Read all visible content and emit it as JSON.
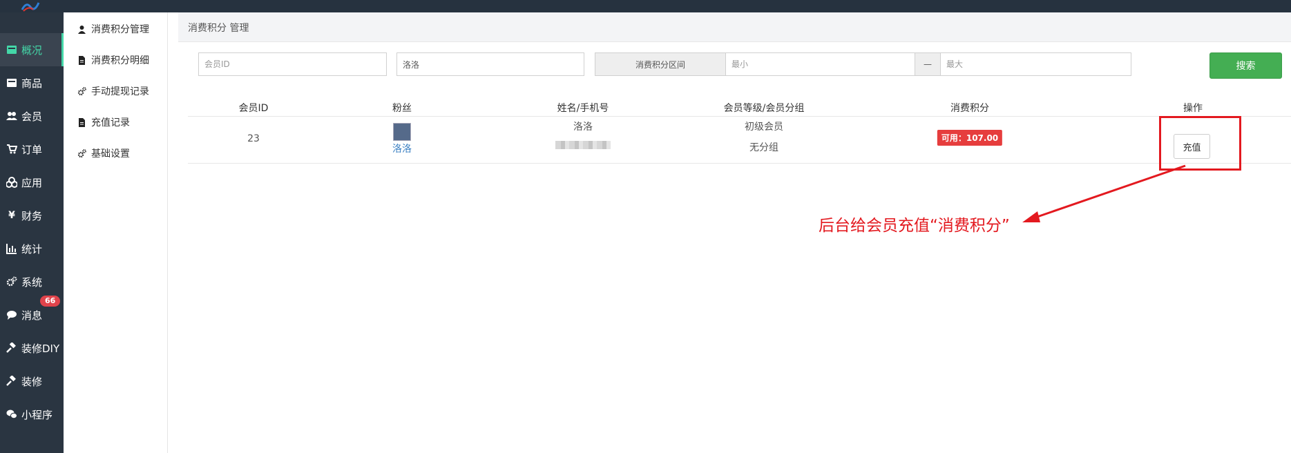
{
  "sidebar": {
    "items": [
      {
        "label": "概况",
        "icon": "dashboard-icon",
        "active": true
      },
      {
        "label": "商品",
        "icon": "goods-icon"
      },
      {
        "label": "会员",
        "icon": "users-icon"
      },
      {
        "label": "订单",
        "icon": "cart-icon"
      },
      {
        "label": "应用",
        "icon": "apps-icon"
      },
      {
        "label": "财务",
        "icon": "yen-icon"
      },
      {
        "label": "统计",
        "icon": "bar-chart-icon"
      },
      {
        "label": "系统",
        "icon": "gears-icon"
      },
      {
        "label": "消息",
        "icon": "comment-icon",
        "badge": "66"
      },
      {
        "label": "装修DIY",
        "icon": "gavel-icon"
      },
      {
        "label": "装修",
        "icon": "gavel-icon"
      },
      {
        "label": "小程序",
        "icon": "wechat-icon"
      }
    ]
  },
  "submenu": {
    "items": [
      {
        "label": "消费积分管理",
        "icon": "user-icon"
      },
      {
        "label": "消费积分明细",
        "icon": "file-icon"
      },
      {
        "label": "手动提现记录",
        "icon": "gears-icon"
      },
      {
        "label": "充值记录",
        "icon": "file-icon"
      },
      {
        "label": "基础设置",
        "icon": "gears-icon"
      }
    ]
  },
  "breadcrumb": "消费积分 管理",
  "filters": {
    "member_id_placeholder": "会员ID",
    "name_value": "洛洛",
    "range_label": "消费积分区间",
    "min_placeholder": "最小",
    "separator": "—",
    "max_placeholder": "最大",
    "search_label": "搜索"
  },
  "table": {
    "headers": [
      "会员ID",
      "粉丝",
      "姓名/手机号",
      "会员等级/会员分组",
      "消费积分",
      "操作"
    ],
    "rows": [
      {
        "member_id": "23",
        "fan_nickname": "洛洛",
        "name": "洛洛",
        "level": "初级会员",
        "group": "无分组",
        "points": "可用：107.00",
        "action": "充值"
      }
    ]
  },
  "annotation": {
    "text": "后台给会员充值“消费积分”",
    "color": "#e3191f"
  },
  "colors": {
    "sidebar_bg": "#2a3541",
    "accent": "#44d7a8",
    "search_button": "#44ae53",
    "points_badge": "#e63d3d"
  }
}
